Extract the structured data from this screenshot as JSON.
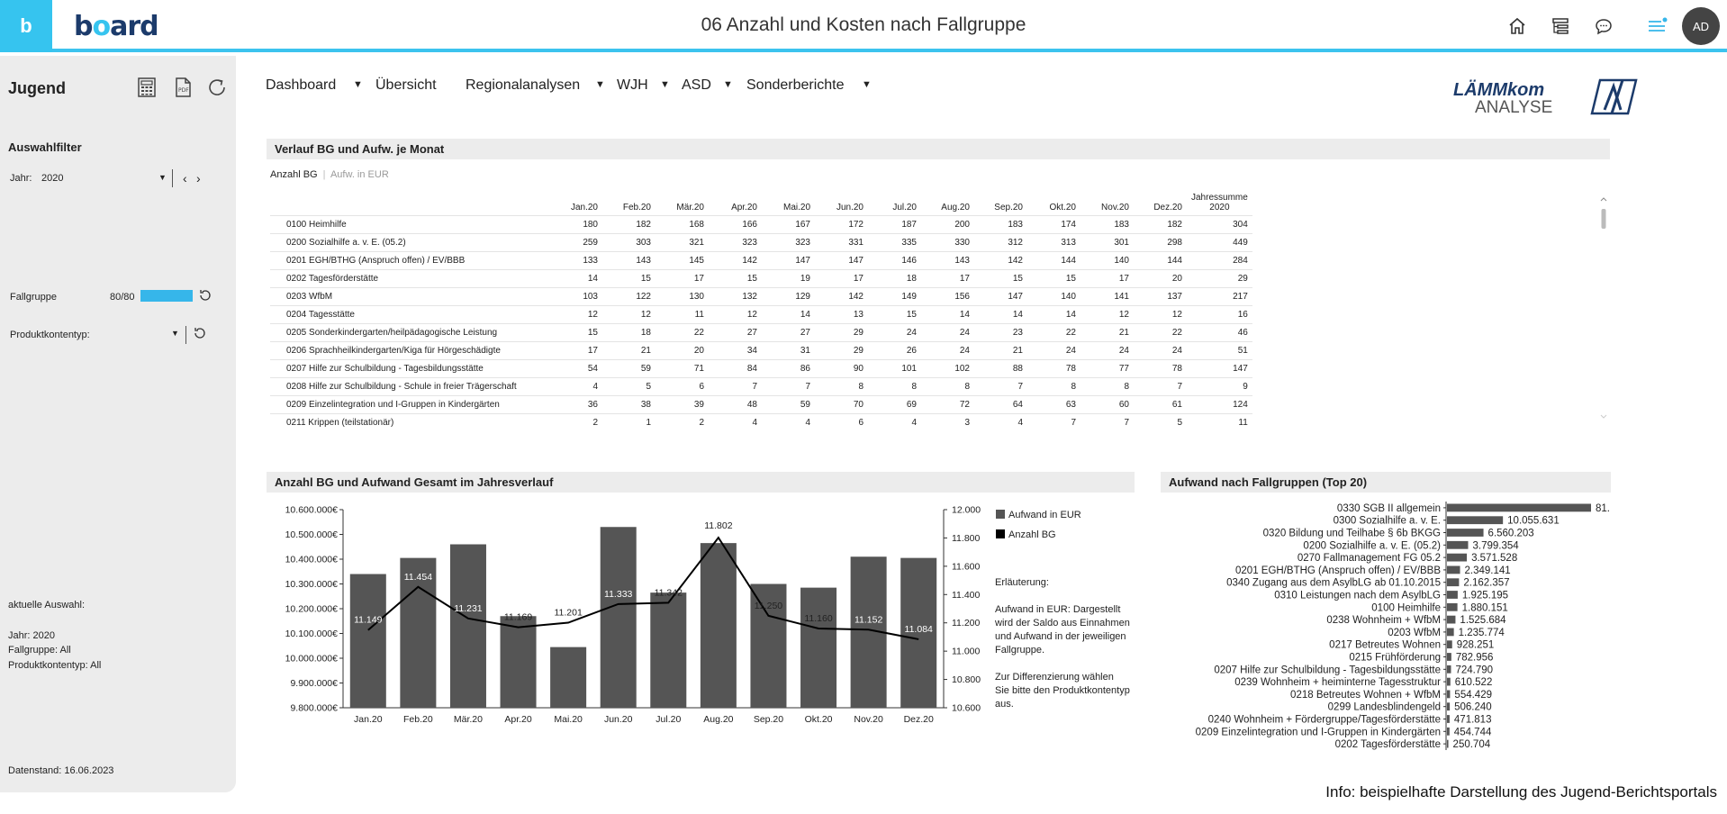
{
  "topbar": {
    "logo_letter": "b",
    "brand_pre": "b",
    "brand_o": "o",
    "brand_post": "ard",
    "title": "06 Anzahl und Kosten nach Fallgruppe",
    "icons": [
      "home-icon",
      "hierarchy-icon",
      "chat-icon",
      "menu-icon"
    ],
    "avatar": "AD"
  },
  "sidebar": {
    "title": "Jugend",
    "icons": [
      "calculator-icon",
      "pdf-icon",
      "refresh-icon"
    ],
    "filter_title": "Auswahlfilter",
    "jahr_label": "Jahr:",
    "jahr_value": "2020",
    "fallgruppe_label": "Fallgruppe",
    "fallgruppe_count": "80/80",
    "produkt_label": "Produktkontentyp:",
    "current_label": "aktuelle Auswahl:",
    "current_jahr": "Jahr: 2020",
    "current_fallgruppe": "Fallgruppe: All",
    "current_produkt": "Produktkontentyp: All",
    "datenstand": "Datenstand: 16.06.2023"
  },
  "menu": {
    "items": [
      "Dashboard",
      "Übersicht",
      "Regionalanalysen",
      "WJH",
      "ASD",
      "Sonderberichte"
    ]
  },
  "lammkom": {
    "name_top": "LÄMMkom",
    "name_bottom": "ANALYSE"
  },
  "table_panel": {
    "title": "Verlauf BG und Aufw. je Monat",
    "tab_active": "Anzahl BG",
    "tab_sep": "|",
    "tab_inactive": "Aufw. in EUR",
    "columns": [
      "Jan.20",
      "Feb.20",
      "Mär.20",
      "Apr.20",
      "Mai.20",
      "Jun.20",
      "Jul.20",
      "Aug.20",
      "Sep.20",
      "Okt.20",
      "Nov.20",
      "Dez.20"
    ],
    "total_header_1": "Jahressumme",
    "total_header_2": "2020",
    "rows": [
      {
        "name": "0100 Heimhilfe",
        "values": [
          "180",
          "182",
          "168",
          "166",
          "167",
          "172",
          "187",
          "200",
          "183",
          "174",
          "183",
          "182"
        ],
        "total": "304"
      },
      {
        "name": "0200 Sozialhilfe a. v. E. (05.2)",
        "values": [
          "259",
          "303",
          "321",
          "323",
          "323",
          "331",
          "335",
          "330",
          "312",
          "313",
          "301",
          "298"
        ],
        "total": "449"
      },
      {
        "name": "0201 EGH/BTHG (Anspruch offen) / EV/BBB",
        "values": [
          "133",
          "143",
          "145",
          "142",
          "147",
          "147",
          "146",
          "143",
          "142",
          "144",
          "140",
          "144"
        ],
        "total": "284"
      },
      {
        "name": "0202 Tagesförderstätte",
        "values": [
          "14",
          "15",
          "17",
          "15",
          "19",
          "17",
          "18",
          "17",
          "15",
          "15",
          "17",
          "20"
        ],
        "total": "29"
      },
      {
        "name": "0203 WfbM",
        "values": [
          "103",
          "122",
          "130",
          "132",
          "129",
          "142",
          "149",
          "156",
          "147",
          "140",
          "141",
          "137"
        ],
        "total": "217"
      },
      {
        "name": "0204 Tagesstätte",
        "values": [
          "12",
          "12",
          "11",
          "12",
          "14",
          "13",
          "15",
          "14",
          "14",
          "14",
          "12",
          "12"
        ],
        "total": "16"
      },
      {
        "name": "0205 Sonderkindergarten/heilpädagogische Leistung",
        "values": [
          "15",
          "18",
          "22",
          "27",
          "27",
          "29",
          "24",
          "24",
          "23",
          "22",
          "21",
          "22"
        ],
        "total": "46"
      },
      {
        "name": "0206 Sprachheilkindergarten/Kiga für Hörgeschädigte",
        "values": [
          "17",
          "21",
          "20",
          "34",
          "31",
          "29",
          "26",
          "24",
          "21",
          "24",
          "24",
          "24"
        ],
        "total": "51"
      },
      {
        "name": "0207 Hilfe zur Schulbildung - Tagesbildungsstätte",
        "values": [
          "54",
          "59",
          "71",
          "84",
          "86",
          "90",
          "101",
          "102",
          "88",
          "78",
          "77",
          "78"
        ],
        "total": "147"
      },
      {
        "name": "0208 Hilfe zur Schulbildung - Schule in freier Trägerschaft",
        "values": [
          "4",
          "5",
          "6",
          "7",
          "7",
          "8",
          "8",
          "8",
          "7",
          "8",
          "8",
          "7"
        ],
        "total": "9"
      },
      {
        "name": "0209 Einzelintegration und I-Gruppen in Kindergärten",
        "values": [
          "36",
          "38",
          "39",
          "48",
          "59",
          "70",
          "69",
          "72",
          "64",
          "63",
          "60",
          "61"
        ],
        "total": "124"
      },
      {
        "name": "0211 Krippen (teilstationär)",
        "values": [
          "2",
          "1",
          "2",
          "4",
          "4",
          "6",
          "4",
          "3",
          "4",
          "7",
          "7",
          "5"
        ],
        "total": "11"
      }
    ]
  },
  "combo_panel": {
    "title": "Anzahl BG und Aufwand Gesamt im Jahresverlauf",
    "explanation_title": "Erläuterung:",
    "explanation_1": "Aufwand in EUR: Dargestellt wird der Saldo aus Einnahmen und Aufwand in der jeweiligen Fallgruppe.",
    "explanation_2": "Zur Differenzierung wählen Sie bitte den Produktkontentyp aus."
  },
  "top20_panel": {
    "title": "Aufwand nach Fallgruppen (Top 20)"
  },
  "footer": {
    "info": "Info: beispielhafte Darstellung des Jugend-Berichtsportals"
  },
  "colors": {
    "accent": "#36c4ef",
    "bar": "#555555",
    "line": "#000000",
    "header_bg": "#ececec"
  },
  "chart_data": [
    {
      "type": "bar",
      "title": "Anzahl BG und Aufwand Gesamt im Jahresverlauf",
      "categories": [
        "Jan.20",
        "Feb.20",
        "Mär.20",
        "Apr.20",
        "Mai.20",
        "Jun.20",
        "Jul.20",
        "Aug.20",
        "Sep.20",
        "Okt.20",
        "Nov.20",
        "Dez.20"
      ],
      "series": [
        {
          "name": "Aufwand in EUR",
          "type": "bar",
          "axis": "left",
          "values": [
            10340000,
            10405000,
            10460000,
            10170000,
            10045000,
            10530000,
            10265000,
            10465000,
            10300000,
            10285000,
            10410000,
            10405000
          ]
        },
        {
          "name": "Anzahl BG",
          "type": "line",
          "axis": "right",
          "values": [
            11149,
            11454,
            11231,
            11169,
            11201,
            11333,
            11342,
            11802,
            11250,
            11160,
            11152,
            11084
          ],
          "labels": [
            "11.149",
            "11.454",
            "11.231",
            "11.169",
            "11.201",
            "11.333",
            "11.342",
            "11.802",
            "11.250",
            "11.160",
            "11.152",
            "11.084"
          ]
        }
      ],
      "y_left": {
        "min": 9800000,
        "max": 10600000,
        "step": 100000,
        "ticks": [
          "9.800.000€",
          "9.900.000€",
          "10.000.000€",
          "10.100.000€",
          "10.200.000€",
          "10.300.000€",
          "10.400.000€",
          "10.500.000€",
          "10.600.000€"
        ]
      },
      "y_right": {
        "min": 10600,
        "max": 12000,
        "step": 200,
        "ticks": [
          "10.600",
          "10.800",
          "11.000",
          "11.200",
          "11.400",
          "11.600",
          "11.800",
          "12.000"
        ]
      },
      "legend": [
        "Aufwand in EUR",
        "Anzahl BG"
      ],
      "legend_position": "right"
    },
    {
      "type": "bar",
      "orientation": "horizontal",
      "title": "Aufwand nach Fallgruppen (Top 20)",
      "categories": [
        "0330 SGB II allgemein",
        "0300 Sozialhilfe a. v. E.",
        "0320 Bildung und Teilhabe § 6b BKGG",
        "0200 Sozialhilfe a. v. E. (05.2)",
        "0270 Fallmanagement FG 05.2",
        "0201 EGH/BTHG (Anspruch offen) / EV/BBB",
        "0340 Zugang aus dem AsylbLG ab 01.10.2015",
        "0310 Leistungen nach dem AsylbLG",
        "0100 Heimhilfe",
        "0238 Wohnheim + WfbM",
        "0203 WfbM",
        "0217 Betreutes Wohnen",
        "0215 Frühförderung",
        "0207 Hilfe zur Schulbildung - Tagesbildungsstätte",
        "0239 Wohnheim + heiminterne Tagesstruktur",
        "0218 Betreutes Wohnen + WfbM",
        "0299 Landesblindengeld",
        "0240 Wohnheim + Fördergruppe/Tagesförderstätte",
        "0209 Einzelintegration und I-Gruppen in Kindergärten",
        "0202 Tagesförderstätte"
      ],
      "values": [
        81000000,
        10055631,
        6560203,
        3799354,
        3571528,
        2349141,
        2162357,
        1925195,
        1880151,
        1525684,
        1235774,
        928251,
        782956,
        724790,
        610522,
        554429,
        506240,
        471813,
        454744,
        250704
      ],
      "labels": [
        "81.",
        "10.055.631",
        "6.560.203",
        "3.799.354",
        "3.571.528",
        "2.349.141",
        "2.162.357",
        "1.925.195",
        "1.880.151",
        "1.525.684",
        "1.235.774",
        "928.251",
        "782.956",
        "724.790",
        "610.522",
        "554.429",
        "506.240",
        "471.813",
        "454.744",
        "250.704"
      ]
    }
  ]
}
